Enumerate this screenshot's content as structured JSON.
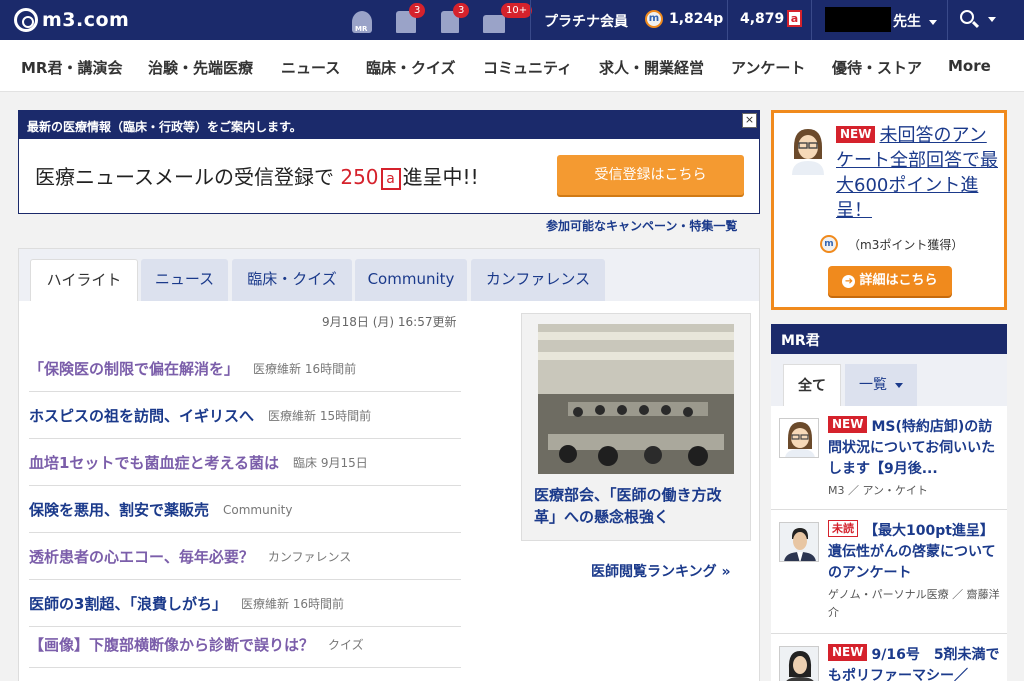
{
  "header": {
    "logo_text": "m3.com",
    "mr_label": "MR",
    "badges": {
      "messages": "3",
      "tasks": "3",
      "gifts": "10+"
    },
    "membership": "プラチナ会員",
    "m_points_icon": "m",
    "m_points": "1,824p",
    "a_points": "4,879",
    "a_points_icon": "a",
    "user_suffix": "先生"
  },
  "nav": {
    "items": [
      "MR君・講演会",
      "治験・先端医療",
      "ニュース",
      "臨床・クイズ",
      "コミュニティ",
      "求人・開業経営",
      "アンケート",
      "優待・ストア",
      "More"
    ]
  },
  "notice": {
    "header": "最新の医療情報（臨床・行政等）をご案内します。",
    "close_label": "×",
    "body_before": "医療ニュースメールの受信登録で",
    "body_amount": "250",
    "body_unit": "a",
    "body_after": "進呈中!!",
    "button_label": "受信登録はこちら",
    "campaign_link": "参加可能なキャンペーン・特集一覧"
  },
  "tabs": [
    "ハイライト",
    "ニュース",
    "臨床・クイズ",
    "Community",
    "カンファレンス"
  ],
  "highlight": {
    "updated": "9月18日 (月) 16:57更新",
    "items": [
      {
        "title": "「保険医の制限で偏在解消を」",
        "meta": "医療維新 16時間前"
      },
      {
        "title": "ホスピスの祖を訪問、イギリスへ",
        "meta": "医療維新 15時間前"
      },
      {
        "title": "血培1セットでも菌血症と考える菌は",
        "meta": "臨床 9月15日"
      },
      {
        "title": "保険を悪用、割安で薬販売",
        "meta": "Community"
      },
      {
        "title": "透析患者の心エコー、毎年必要？",
        "meta": "カンファレンス"
      },
      {
        "title": "医師の3割超、「浪費しがち」",
        "meta": "医療維新 16時間前"
      },
      {
        "title": "【画像】下腹部横断像から診断で誤りは？",
        "meta": "クイズ"
      }
    ],
    "feature_title": "医療部会、「医師の働き方改革」への懸念根強く",
    "ranking_link": "医師閲覧ランキング »"
  },
  "promo": {
    "new_label": "NEW",
    "text": "未回答のアンケート全部回答で最大600ポイント進呈！",
    "note_icon": "m",
    "note": "（m3ポイント獲得）",
    "button_label": "詳細はこちら",
    "button_arrow": "➜"
  },
  "mr": {
    "title": "MR君",
    "tab_all": "全て",
    "tab_list": "一覧",
    "items": [
      {
        "badge": "NEW",
        "title": "MS(特約店卸)の訪問状況についてお伺いいたします【9月後...",
        "meta": "M3 ／ アン・ケイト"
      },
      {
        "badge": "未読",
        "title": "【最大100pt進呈】遺伝性がんの啓蒙についてのアンケート",
        "meta": "ゲノム・パーソナル医療 ／ 齋藤洋介"
      },
      {
        "badge": "NEW",
        "title": "9/16号　5剤未満でもポリファーマシー／",
        "meta": ""
      }
    ]
  }
}
